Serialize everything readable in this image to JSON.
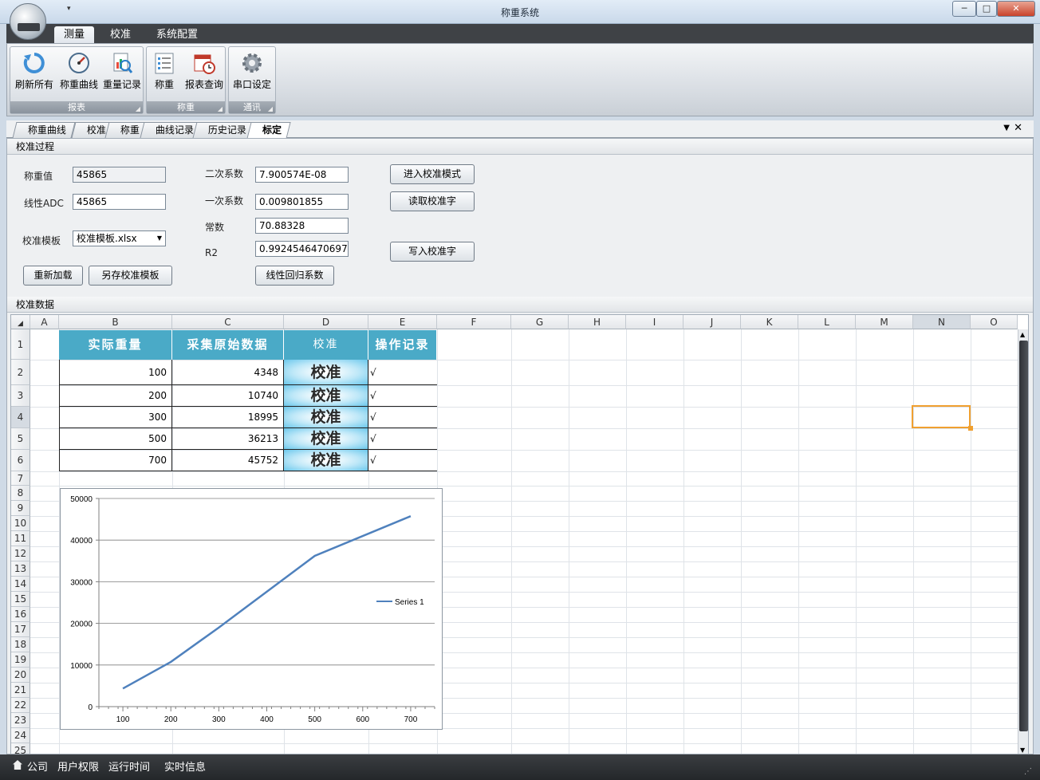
{
  "window": {
    "title": "称重系统",
    "minimize": "─",
    "maximize": "□",
    "close": "✕"
  },
  "ribbon_tabs": [
    "测量",
    "校准",
    "系统配置"
  ],
  "ribbon": {
    "groups": [
      {
        "label": "报表",
        "buttons": [
          "刷新所有",
          "称重曲线",
          "重量记录"
        ]
      },
      {
        "label": "称重",
        "buttons": [
          "称重",
          "报表查询"
        ]
      },
      {
        "label": "通讯",
        "buttons": [
          "串口设定"
        ]
      }
    ]
  },
  "doc_tabs": [
    "称重曲线",
    "校准",
    "称重",
    "曲线记录",
    "历史记录",
    "标定"
  ],
  "calibration": {
    "section_title": "校准过程",
    "weight_label": "称重值",
    "weight_value": "45865",
    "adc_label": "线性ADC",
    "adc_value": "45865",
    "template_label": "校准模板",
    "template_value": "校准模板.xlsx",
    "quad_label": "二次系数",
    "quad_value": "7.900574E-08",
    "linear_label": "一次系数",
    "linear_value": "0.009801855",
    "const_label": "常数",
    "const_value": "70.88328",
    "r2_label": "R2",
    "r2_value": "0.99245464706971",
    "btn_enter": "进入校准模式",
    "btn_read": "读取校准字",
    "btn_write": "写入校准字",
    "btn_reload": "重新加载",
    "btn_saveas": "另存校准模板",
    "btn_regress": "线性回归系数"
  },
  "sheet": {
    "section_title": "校准数据",
    "columns": [
      "A",
      "B",
      "C",
      "D",
      "E",
      "F",
      "G",
      "H",
      "I",
      "J",
      "K",
      "L",
      "M",
      "N",
      "O"
    ],
    "rows": [
      "1",
      "2",
      "3",
      "4",
      "5",
      "6",
      "7",
      "8",
      "9",
      "10",
      "11",
      "12",
      "13",
      "14",
      "15",
      "16",
      "17",
      "18",
      "19",
      "20",
      "21",
      "22",
      "23",
      "24",
      "25"
    ],
    "headers": [
      "实际重量",
      "采集原始数据",
      "校准",
      "操作记录"
    ],
    "data": [
      {
        "weight": "100",
        "raw": "4348",
        "cal": "校准",
        "op": "√"
      },
      {
        "weight": "200",
        "raw": "10740",
        "cal": "校准",
        "op": "√"
      },
      {
        "weight": "300",
        "raw": "18995",
        "cal": "校准",
        "op": "√"
      },
      {
        "weight": "500",
        "raw": "36213",
        "cal": "校准",
        "op": "√"
      },
      {
        "weight": "700",
        "raw": "45752",
        "cal": "校准",
        "op": "√"
      }
    ]
  },
  "chart_data": {
    "type": "line",
    "x": [
      100,
      200,
      300,
      500,
      700
    ],
    "series": [
      {
        "name": "Series 1",
        "values": [
          4348,
          10740,
          18995,
          36213,
          45752
        ],
        "color": "#4f81bd"
      }
    ],
    "xticks": [
      "100",
      "200",
      "300",
      "400",
      "500",
      "600",
      "700"
    ],
    "yticks": [
      "0",
      "10000",
      "20000",
      "30000",
      "40000",
      "50000"
    ],
    "xlim": [
      50,
      750
    ],
    "ylim": [
      0,
      50000
    ],
    "grid": true,
    "legend": "right"
  },
  "status": [
    "公司",
    "用户权限",
    "运行时间",
    "实时信息"
  ]
}
